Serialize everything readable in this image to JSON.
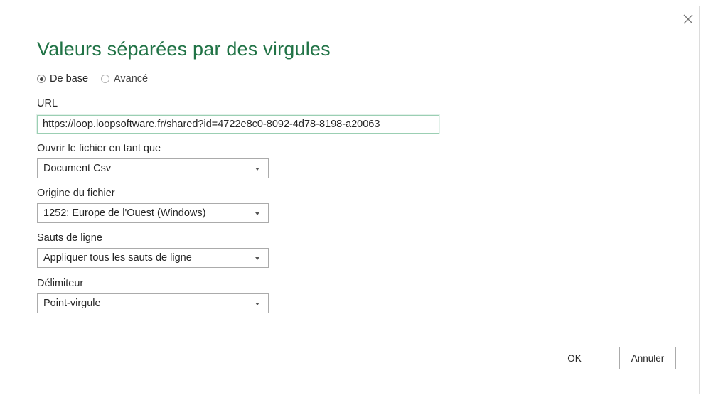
{
  "dialog": {
    "title": "Valeurs séparées par des virgules",
    "close_icon": "close-icon"
  },
  "mode": {
    "options": [
      {
        "label": "De base",
        "checked": true
      },
      {
        "label": "Avancé",
        "checked": false
      }
    ]
  },
  "url": {
    "label": "URL",
    "value": "https://loop.loopsoftware.fr/shared?id=4722e8c0-8092-4d78-8198-a20063"
  },
  "open_as": {
    "label": "Ouvrir le fichier en tant que",
    "value": "Document Csv"
  },
  "file_origin": {
    "label": "Origine du fichier",
    "value": "1252: Europe de l'Ouest (Windows)"
  },
  "line_breaks": {
    "label": "Sauts de ligne",
    "value": "Appliquer tous les sauts de ligne"
  },
  "delimiter": {
    "label": "Délimiteur",
    "value": "Point-virgule"
  },
  "buttons": {
    "ok": "OK",
    "cancel": "Annuler"
  },
  "colors": {
    "accent": "#217346",
    "border": "#ababab"
  }
}
